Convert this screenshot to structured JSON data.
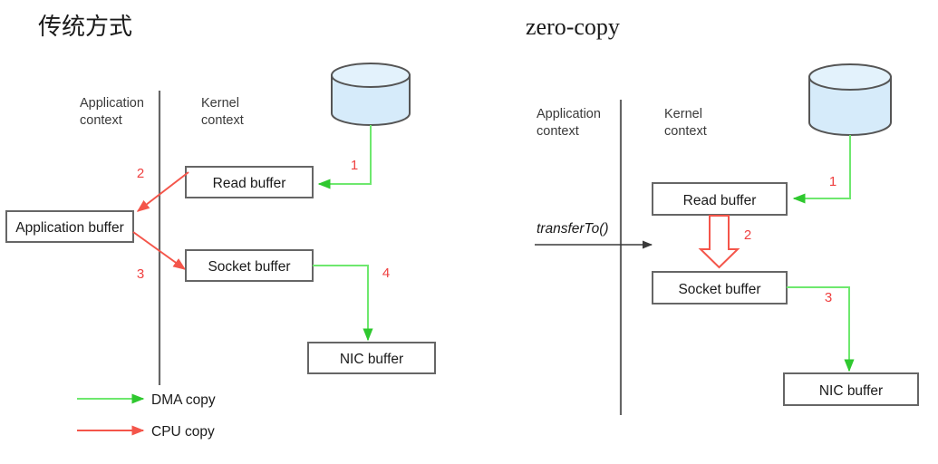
{
  "panels": [
    {
      "id": "traditional",
      "title": "传统方式",
      "contexts": {
        "application": "Application\ncontext",
        "app_line1": "Application",
        "app_line2": "context",
        "kernel_line1": "Kernel",
        "kernel_line2": "context"
      },
      "boxes": [
        {
          "name": "read-buffer",
          "label": "Read buffer"
        },
        {
          "name": "application-buffer",
          "label": "Application buffer"
        },
        {
          "name": "socket-buffer",
          "label": "Socket buffer"
        },
        {
          "name": "nic-buffer",
          "label": "NIC buffer"
        }
      ],
      "steps": [
        {
          "num": "1",
          "kind": "dma",
          "from": "disk",
          "to": "read-buffer"
        },
        {
          "num": "2",
          "kind": "cpu",
          "from": "read-buffer",
          "to": "application-buffer"
        },
        {
          "num": "3",
          "kind": "cpu",
          "from": "application-buffer",
          "to": "socket-buffer"
        },
        {
          "num": "4",
          "kind": "dma",
          "from": "socket-buffer",
          "to": "nic-buffer"
        }
      ],
      "disk": "disk-cylinder"
    },
    {
      "id": "zero-copy",
      "title": "zero-copy",
      "contexts": {
        "app_line1": "Application",
        "app_line2": "context",
        "kernel_line1": "Kernel",
        "kernel_line2": "context"
      },
      "api_call": "transferTo()",
      "boxes": [
        {
          "name": "read-buffer",
          "label": "Read buffer"
        },
        {
          "name": "socket-buffer",
          "label": "Socket buffer"
        },
        {
          "name": "nic-buffer",
          "label": "NIC buffer"
        }
      ],
      "steps": [
        {
          "num": "1",
          "kind": "dma",
          "from": "disk",
          "to": "read-buffer"
        },
        {
          "num": "2",
          "kind": "cpu",
          "from": "read-buffer",
          "to": "socket-buffer"
        },
        {
          "num": "3",
          "kind": "dma",
          "from": "socket-buffer",
          "to": "nic-buffer"
        }
      ],
      "disk": "disk-cylinder"
    }
  ],
  "legend": [
    {
      "name": "dma-copy",
      "label": "DMA copy",
      "color": "#6ee86e"
    },
    {
      "name": "cpu-copy",
      "label": "CPU copy",
      "color": "#f4554a"
    }
  ],
  "colors": {
    "dma": "#6ee86e",
    "cpu": "#f4554a",
    "box_stroke": "#666666",
    "disk_fill": "#d6ebfa",
    "text": "#1a1a1a",
    "context_text": "#3a3a3a"
  }
}
